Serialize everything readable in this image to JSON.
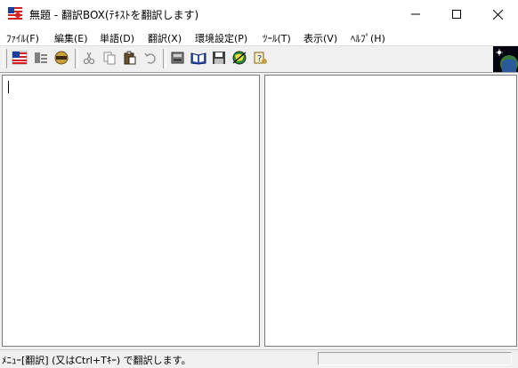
{
  "window": {
    "title": "無題 - 翻訳BOX(ﾃｷｽﾄを翻訳します)"
  },
  "menu": [
    {
      "label": "ﾌｧｲﾙ(F)"
    },
    {
      "label": "編集(E)"
    },
    {
      "label": "単語(D)"
    },
    {
      "label": "翻訳(X)"
    },
    {
      "label": "環境設定(P)"
    },
    {
      "label": "ﾂｰﾙ(T)"
    },
    {
      "label": "表示(V)"
    },
    {
      "label": "ﾍﾙﾌﾟ(H)"
    }
  ],
  "toolbar": {
    "icons": [
      "english-flag-icon",
      "translate-settings-icon",
      "auto-translate-icon",
      "cut-icon",
      "copy-icon",
      "paste-icon",
      "undo-icon",
      "dictionary-icon",
      "book-icon",
      "save-icon",
      "globe-icon",
      "help-icon"
    ]
  },
  "statusbar": {
    "text": "ﾒﾆｭｰ[翻訳] (又はCtrl+Tｷｰ) で翻訳します。"
  },
  "colors": {
    "accent_red": "#d42020",
    "accent_blue": "#1a3f9e",
    "toolbar_bg": "#f0f0f0"
  }
}
